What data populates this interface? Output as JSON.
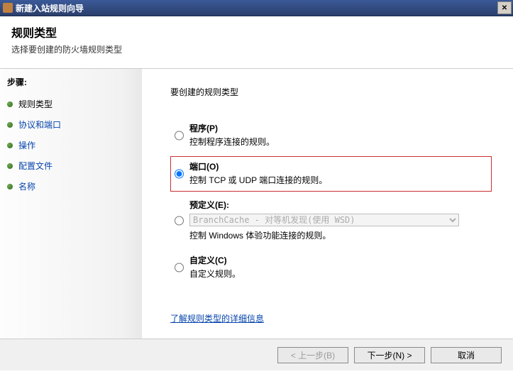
{
  "window": {
    "title": "新建入站规则向导",
    "close_glyph": "✕"
  },
  "header": {
    "title": "规则类型",
    "subtitle": "选择要创建的防火墙规则类型"
  },
  "sidebar": {
    "steps_label": "步骤:",
    "items": [
      {
        "label": "规则类型",
        "current": true
      },
      {
        "label": "协议和端口"
      },
      {
        "label": "操作"
      },
      {
        "label": "配置文件"
      },
      {
        "label": "名称"
      }
    ]
  },
  "content": {
    "heading": "要创建的规则类型",
    "options": [
      {
        "id": "program",
        "title": "程序(P)",
        "desc": "控制程序连接的规则。",
        "selected": false,
        "highlighted": false
      },
      {
        "id": "port",
        "title": "端口(O)",
        "desc": "控制 TCP 或 UDP 端口连接的规则。",
        "selected": true,
        "highlighted": true
      },
      {
        "id": "predefined",
        "title": "预定义(E):",
        "desc_below": "控制 Windows 体验功能连接的规则。",
        "combo_value": "BranchCache - 对等机发现(使用 WSD)",
        "combo_enabled": false,
        "selected": false,
        "highlighted": false
      },
      {
        "id": "custom",
        "title": "自定义(C)",
        "desc": "自定义规则。",
        "selected": false,
        "highlighted": false
      }
    ],
    "help_link": "了解规则类型的详细信息"
  },
  "footer": {
    "back": "< 上一步(B)",
    "next": "下一步(N) >",
    "cancel": "取消"
  }
}
